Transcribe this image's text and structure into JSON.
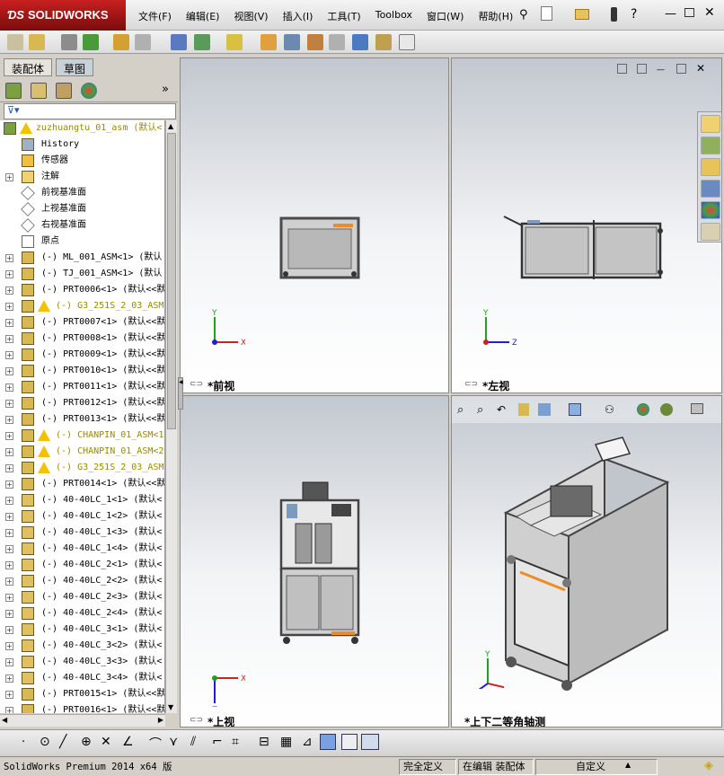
{
  "app": {
    "logo_text": "SOLIDWORKS"
  },
  "menu": [
    "文件(F)",
    "编辑(E)",
    "视图(V)",
    "插入(I)",
    "工具(T)",
    "Toolbox",
    "窗口(W)",
    "帮助(H)"
  ],
  "feature_manager": {
    "tabs": [
      "装配体",
      "草图"
    ],
    "root": "zuzhuangtu_01_asm  (默认<",
    "items": [
      {
        "label": "History",
        "icon": "history-icon",
        "warn": false,
        "expand": false
      },
      {
        "label": "传感器",
        "icon": "sensor-icon",
        "warn": false,
        "expand": false
      },
      {
        "label": "注解",
        "icon": "annotation-icon",
        "warn": false,
        "expand": true
      },
      {
        "label": "前视基准面",
        "icon": "plane-icon",
        "warn": false,
        "expand": false
      },
      {
        "label": "上视基准面",
        "icon": "plane-icon",
        "warn": false,
        "expand": false
      },
      {
        "label": "右视基准面",
        "icon": "plane-icon",
        "warn": false,
        "expand": false
      },
      {
        "label": "原点",
        "icon": "origin-icon",
        "warn": false,
        "expand": false
      },
      {
        "label": "(-) ML_001_ASM<1> (默认",
        "icon": "assembly-icon",
        "warn": false,
        "expand": true
      },
      {
        "label": "(-) TJ_001_ASM<1> (默认",
        "icon": "assembly-icon",
        "warn": false,
        "expand": true
      },
      {
        "label": "(-) PRT0006<1> (默认<<默",
        "icon": "assembly-icon",
        "warn": false,
        "expand": true
      },
      {
        "label": "(-) G3_251S_2_03_ASM",
        "icon": "assembly-icon",
        "warn": true,
        "expand": true
      },
      {
        "label": "(-) PRT0007<1> (默认<<默",
        "icon": "assembly-icon",
        "warn": false,
        "expand": true
      },
      {
        "label": "(-) PRT0008<1> (默认<<默",
        "icon": "assembly-icon",
        "warn": false,
        "expand": true
      },
      {
        "label": "(-) PRT0009<1> (默认<<默",
        "icon": "assembly-icon",
        "warn": false,
        "expand": true
      },
      {
        "label": "(-) PRT0010<1> (默认<<默",
        "icon": "assembly-icon",
        "warn": false,
        "expand": true
      },
      {
        "label": "(-) PRT0011<1> (默认<<默",
        "icon": "assembly-icon",
        "warn": false,
        "expand": true
      },
      {
        "label": "(-) PRT0012<1> (默认<<默",
        "icon": "assembly-icon",
        "warn": false,
        "expand": true
      },
      {
        "label": "(-) PRT0013<1> (默认<<默",
        "icon": "assembly-icon",
        "warn": false,
        "expand": true
      },
      {
        "label": "(-) CHANPIN_01_ASM<1",
        "icon": "assembly-icon",
        "warn": true,
        "expand": true
      },
      {
        "label": "(-) CHANPIN_01_ASM<2",
        "icon": "assembly-icon",
        "warn": true,
        "expand": true
      },
      {
        "label": "(-) G3_251S_2_03_ASM",
        "icon": "assembly-icon",
        "warn": true,
        "expand": true
      },
      {
        "label": "(-) PRT0014<1> (默认<<默",
        "icon": "assembly-icon",
        "warn": false,
        "expand": true
      },
      {
        "label": "(-) 40-40LC_1<1> (默认<",
        "icon": "part-icon",
        "warn": false,
        "expand": true
      },
      {
        "label": "(-) 40-40LC_1<2> (默认<",
        "icon": "part-icon",
        "warn": false,
        "expand": true
      },
      {
        "label": "(-) 40-40LC_1<3> (默认<",
        "icon": "part-icon",
        "warn": false,
        "expand": true
      },
      {
        "label": "(-) 40-40LC_1<4> (默认<",
        "icon": "part-icon",
        "warn": false,
        "expand": true
      },
      {
        "label": "(-) 40-40LC_2<1> (默认<",
        "icon": "part-icon",
        "warn": false,
        "expand": true
      },
      {
        "label": "(-) 40-40LC_2<2> (默认<",
        "icon": "part-icon",
        "warn": false,
        "expand": true
      },
      {
        "label": "(-) 40-40LC_2<3> (默认<",
        "icon": "part-icon",
        "warn": false,
        "expand": true
      },
      {
        "label": "(-) 40-40LC_2<4> (默认<",
        "icon": "part-icon",
        "warn": false,
        "expand": true
      },
      {
        "label": "(-) 40-40LC_3<1> (默认<",
        "icon": "part-icon",
        "warn": false,
        "expand": true
      },
      {
        "label": "(-) 40-40LC_3<2> (默认<",
        "icon": "part-icon",
        "warn": false,
        "expand": true
      },
      {
        "label": "(-) 40-40LC_3<3> (默认<",
        "icon": "part-icon",
        "warn": false,
        "expand": true
      },
      {
        "label": "(-) 40-40LC_3<4> (默认<",
        "icon": "part-icon",
        "warn": false,
        "expand": true
      },
      {
        "label": "(-) PRT0015<1> (默认<<默",
        "icon": "assembly-icon",
        "warn": false,
        "expand": true
      },
      {
        "label": "(-) PRT0016<1> (默认<<默",
        "icon": "assembly-icon",
        "warn": false,
        "expand": true
      }
    ]
  },
  "viewports": {
    "front": {
      "label": "*前视",
      "axes": [
        "X",
        "Y"
      ]
    },
    "left": {
      "label": "*左视",
      "axes": [
        "Z",
        "Y"
      ]
    },
    "top": {
      "label": "*上视",
      "axes": [
        "X",
        "Z"
      ]
    },
    "iso": {
      "label": "*上下二等角轴测",
      "axes": [
        "X",
        "Y",
        "Z"
      ]
    }
  },
  "statusbar": {
    "product": "SolidWorks Premium 2014 x64 版",
    "state": "完全定义",
    "mode": "在编辑 装配体",
    "units": "自定义"
  },
  "colors": {
    "accent_orange": "#f08a24",
    "frame_gray": "#8c8c8c",
    "panel_gray": "#d0d0d0",
    "warn_yellow": "#f2c200"
  }
}
